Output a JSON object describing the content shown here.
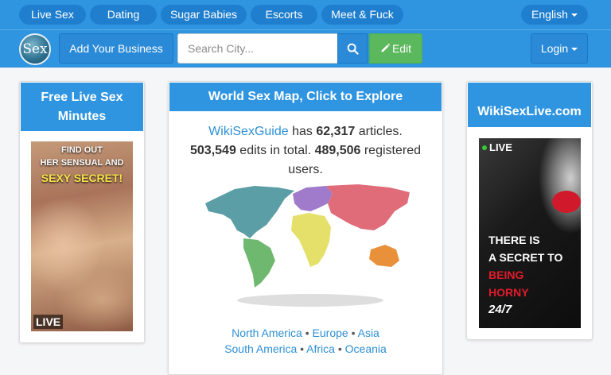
{
  "topnav": {
    "pills": [
      "Live Sex",
      "Dating",
      "Sugar Babies",
      "Escorts",
      "Meet & Fuck"
    ],
    "language": "English"
  },
  "navbar": {
    "logo_text": "Sex",
    "add_business": "Add Your Business",
    "search_placeholder": "Search City...",
    "edit_label": "Edit",
    "login_label": "Login"
  },
  "left_panel": {
    "title_line1": "Free Live Sex",
    "title_line2": "Minutes",
    "ad": {
      "line1": "FIND OUT",
      "line2": "HER SENSUAL AND",
      "line3": "SEXY SECRET!",
      "badge": "LIVE"
    }
  },
  "center_panel": {
    "title": "World Sex Map, Click to Explore",
    "site_link": "WikiSexGuide",
    "has_text": " has ",
    "articles_count": "62,317",
    "articles_text": " articles.",
    "edits_count": "503,549",
    "edits_text": " edits in total. ",
    "users_count": "489,506",
    "registered_text": " registered",
    "users_text": "users.",
    "region_links": [
      "North America",
      "Europe",
      "Asia",
      "South America",
      "Africa",
      "Oceania"
    ],
    "separator": " • ",
    "colors": {
      "north_america": "#5b9ea6",
      "south_america": "#6fb86f",
      "europe": "#a07acb",
      "asia": "#e06c7a",
      "africa": "#e4e06a",
      "oceania": "#e8913a",
      "antarctica": "#dedede"
    }
  },
  "right_panel": {
    "title": "WikiSexLive.com",
    "ad": {
      "badge": "LIVE",
      "line1": "THERE IS",
      "line2": "A SECRET TO",
      "line3": "BEING",
      "line4": "HORNY",
      "line5": "24/7"
    }
  }
}
